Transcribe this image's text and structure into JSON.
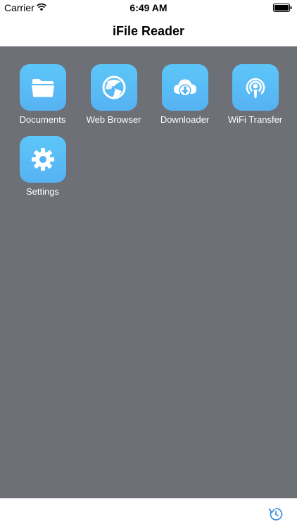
{
  "status_bar": {
    "carrier": "Carrier",
    "time": "6:49 AM",
    "wifi_icon": "wifi-icon",
    "battery_icon": "battery-icon"
  },
  "nav": {
    "title": "iFile Reader"
  },
  "apps": [
    {
      "label": "Documents",
      "icon": "folder-icon"
    },
    {
      "label": "Web Browser",
      "icon": "browser-icon"
    },
    {
      "label": "Downloader",
      "icon": "cloud-download-icon"
    },
    {
      "label": "WiFi Transfer",
      "icon": "wifi-transfer-icon"
    },
    {
      "label": "Settings",
      "icon": "gear-icon"
    }
  ],
  "toolbar": {
    "refresh_icon": "refresh-icon"
  },
  "colors": {
    "content_background": "#6d7076",
    "tile_gradient_top": "#5cc6f8",
    "tile_gradient_bottom": "#56b2f2",
    "accent": "#3d8ee0"
  }
}
